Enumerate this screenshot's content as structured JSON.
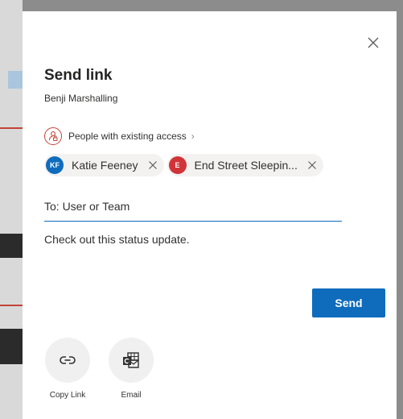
{
  "dialog": {
    "title": "Send link",
    "owner": "Benji Marshalling",
    "access_label": "People with existing access",
    "recipients": [
      {
        "initials": "KF",
        "name": "Katie Feeney",
        "color": "#0f6cbd"
      },
      {
        "initials": "E",
        "name": "End Street Sleepin...",
        "color": "#d13438"
      }
    ],
    "to_placeholder": "To: User or Team",
    "message": "Check out this status update.",
    "send_label": "Send",
    "share_options": [
      {
        "label": "Copy Link",
        "icon": "link-icon"
      },
      {
        "label": "Email",
        "icon": "outlook-email-icon"
      }
    ]
  },
  "colors": {
    "accent": "#0f6cbd",
    "access_icon": "#c4433a"
  }
}
